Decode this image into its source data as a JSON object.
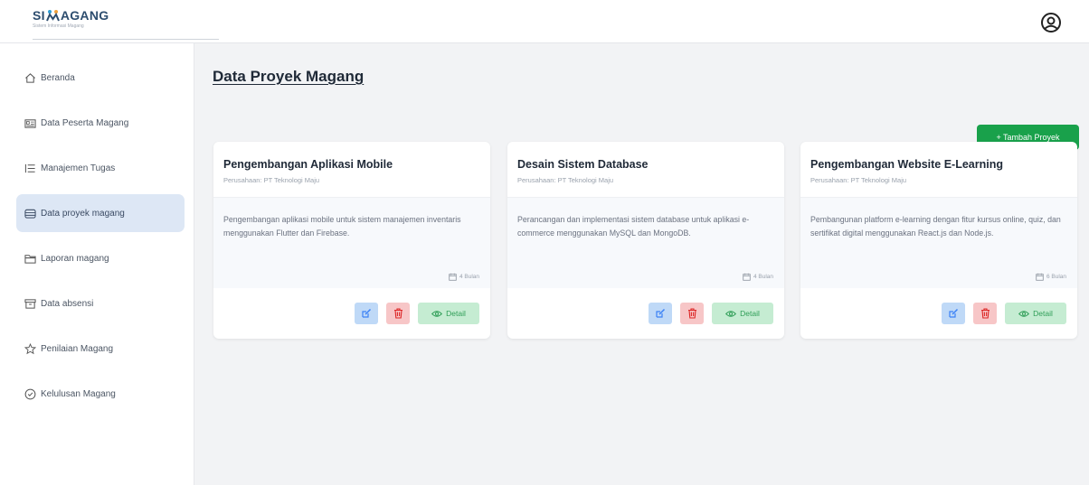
{
  "brand": {
    "name": "SIMAGANG",
    "name_left": "SI",
    "name_right": "AGANG",
    "tagline": "Sistem Informasi Magang"
  },
  "header": {
    "profile_icon": "user-circle-icon"
  },
  "sidebar": {
    "items": [
      {
        "label": "Beranda",
        "icon": "home-icon",
        "active": false
      },
      {
        "label": "Data Peserta Magang",
        "icon": "id-card-icon",
        "active": false
      },
      {
        "label": "Manajemen Tugas",
        "icon": "list-icon",
        "active": false
      },
      {
        "label": "Data proyek magang",
        "icon": "database-icon",
        "active": true
      },
      {
        "label": "Laporan magang",
        "icon": "folder-icon",
        "active": false
      },
      {
        "label": "Data absensi",
        "icon": "archive-icon",
        "active": false
      },
      {
        "label": "Penilaian Magang",
        "icon": "star-icon",
        "active": false
      },
      {
        "label": "Kelulusan Magang",
        "icon": "check-circle-icon",
        "active": false
      }
    ]
  },
  "main": {
    "title": "Data Proyek Magang",
    "add_button": "+ Tambah Proyek",
    "cards": [
      {
        "title": "Pengembangan Aplikasi Mobile",
        "company": "Perusahaan: PT Teknologi Maju",
        "description": "Pengembangan aplikasi mobile untuk sistem manajemen inventaris menggunakan Flutter dan Firebase.",
        "duration": "4 Bulan",
        "detail_label": "Detail"
      },
      {
        "title": "Desain Sistem Database",
        "company": "Perusahaan: PT Teknologi Maju",
        "description": "Perancangan dan implementasi sistem database untuk aplikasi e-commerce menggunakan MySQL dan MongoDB.",
        "duration": "4 Bulan",
        "detail_label": "Detail"
      },
      {
        "title": "Pengembangan Website E-Learning",
        "company": "Perusahaan: PT Teknologi Maju",
        "description": "Pembangunan platform e-learning dengan fitur kursus online, quiz, dan sertifikat digital menggunakan React.js dan Node.js.",
        "duration": "6 Bulan",
        "detail_label": "Detail"
      }
    ]
  },
  "colors": {
    "primary_green": "#19a14b",
    "active_nav_bg": "#dde7f5",
    "edit_bg": "#bfd9f7",
    "delete_bg": "#f7c6c7",
    "detail_bg": "#c5ecd2"
  }
}
